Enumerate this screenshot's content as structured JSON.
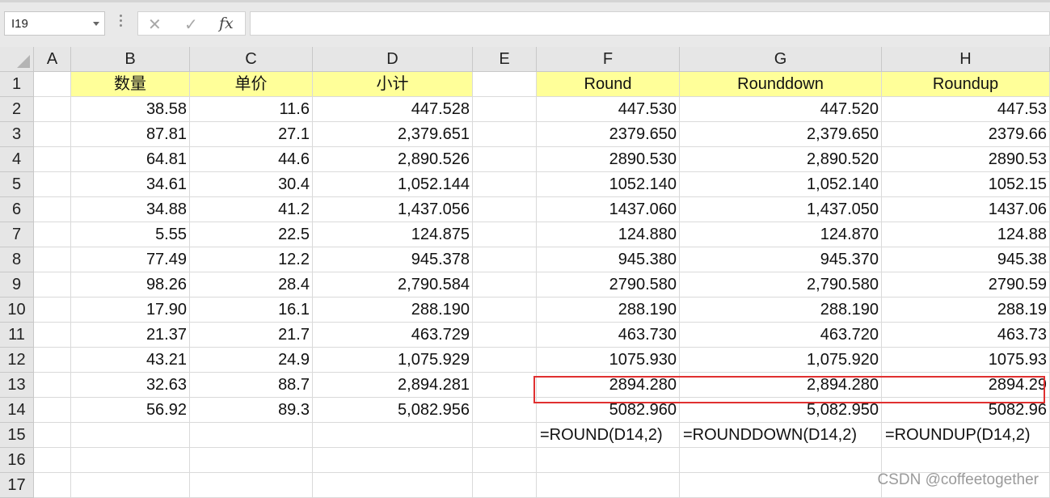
{
  "name_box": {
    "value": "I19"
  },
  "formula_bar": {
    "cancel_icon": "✕",
    "enter_icon": "✓",
    "fx_label": "fx",
    "content": ""
  },
  "columns": [
    "A",
    "B",
    "C",
    "D",
    "E",
    "F",
    "G",
    "H"
  ],
  "row_numbers": [
    "1",
    "2",
    "3",
    "4",
    "5",
    "6",
    "7",
    "8",
    "9",
    "10",
    "11",
    "12",
    "13",
    "14",
    "15",
    "16",
    "17"
  ],
  "header_row": {
    "B": "数量",
    "C": "单价",
    "D": "小计",
    "F": "Round",
    "G": "Rounddown",
    "H": "Roundup"
  },
  "rows": [
    [
      "38.58",
      "11.6",
      "447.528",
      "447.530",
      "447.520",
      "447.53"
    ],
    [
      "87.81",
      "27.1",
      "2,379.651",
      "2379.650",
      "2,379.650",
      "2379.66"
    ],
    [
      "64.81",
      "44.6",
      "2,890.526",
      "2890.530",
      "2,890.520",
      "2890.53"
    ],
    [
      "34.61",
      "30.4",
      "1,052.144",
      "1052.140",
      "1,052.140",
      "1052.15"
    ],
    [
      "34.88",
      "41.2",
      "1,437.056",
      "1437.060",
      "1,437.050",
      "1437.06"
    ],
    [
      "5.55",
      "22.5",
      "124.875",
      "124.880",
      "124.870",
      "124.88"
    ],
    [
      "77.49",
      "12.2",
      "945.378",
      "945.380",
      "945.370",
      "945.38"
    ],
    [
      "98.26",
      "28.4",
      "2,790.584",
      "2790.580",
      "2,790.580",
      "2790.59"
    ],
    [
      "17.90",
      "16.1",
      "288.190",
      "288.190",
      "288.190",
      "288.19"
    ],
    [
      "21.37",
      "21.7",
      "463.729",
      "463.730",
      "463.720",
      "463.73"
    ],
    [
      "43.21",
      "24.9",
      "1,075.929",
      "1075.930",
      "1,075.920",
      "1075.93"
    ],
    [
      "32.63",
      "88.7",
      "2,894.281",
      "2894.280",
      "2,894.280",
      "2894.29"
    ],
    [
      "56.92",
      "89.3",
      "5,082.956",
      "5082.960",
      "5,082.950",
      "5082.96"
    ]
  ],
  "formula_row": {
    "F": "=ROUND(D14,2)",
    "G": "=ROUNDDOWN(D14,2)",
    "H": "=ROUNDUP(D14,2)"
  },
  "watermark": "CSDN @coffeetogether",
  "colors": {
    "header_fill": "#ffff99",
    "highlight_border": "#e03030"
  }
}
